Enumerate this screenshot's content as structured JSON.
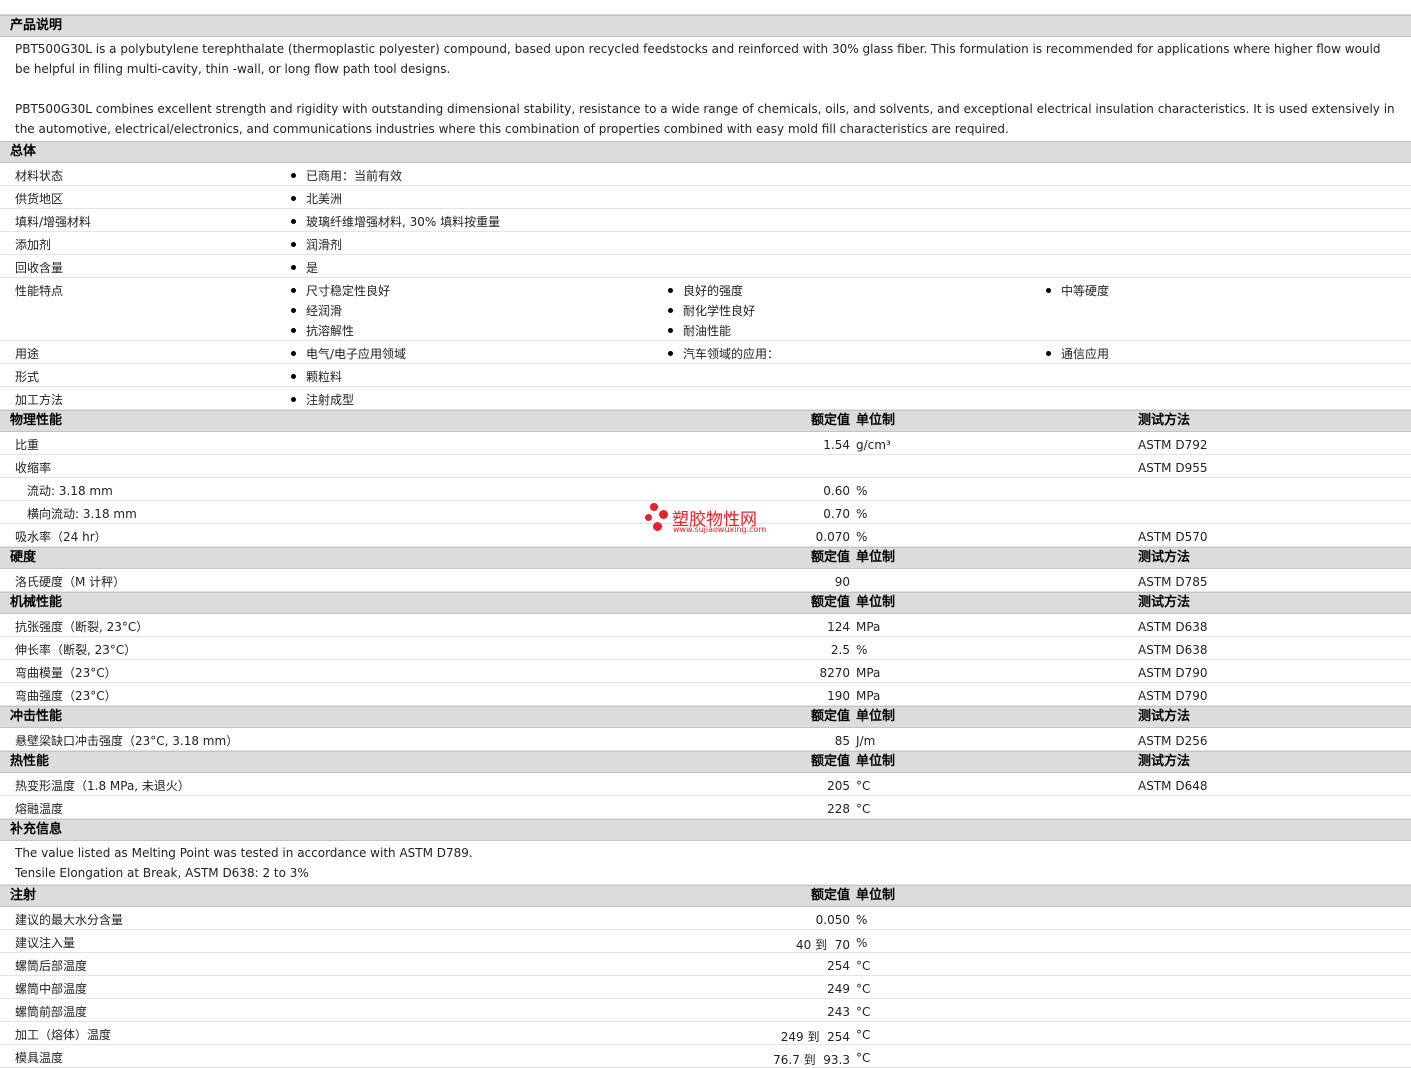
{
  "sections": {
    "desc": {
      "title": "产品说明"
    },
    "general": {
      "title": "总体"
    },
    "physical": {
      "title": "物理性能",
      "h_value": "额定值",
      "h_unit": "单位制",
      "h_method": "测试方法"
    },
    "hardness": {
      "title": "硬度",
      "h_value": "额定值",
      "h_unit": "单位制",
      "h_method": "测试方法"
    },
    "mechanical": {
      "title": "机械性能",
      "h_value": "额定值",
      "h_unit": "单位制",
      "h_method": "测试方法"
    },
    "impact": {
      "title": "冲击性能",
      "h_value": "额定值",
      "h_unit": "单位制",
      "h_method": "测试方法"
    },
    "thermal": {
      "title": "热性能",
      "h_value": "额定值",
      "h_unit": "单位制",
      "h_method": "测试方法"
    },
    "supplement": {
      "title": "补充信息"
    },
    "injection": {
      "title": "注射",
      "h_value": "额定值",
      "h_unit": "单位制"
    }
  },
  "description": {
    "p1": "PBT500G30L is a polybutylene terephthalate (thermoplastic polyester) compound, based upon recycled feedstocks and reinforced with 30% glass fiber. This formulation is recommended for applications where higher flow would be helpful in filing multi-cavity, thin -wall, or long flow path tool designs.",
    "p2": "PBT500G30L combines excellent strength and rigidity with outstanding dimensional stability, resistance to a wide range of chemicals, oils, and solvents, and exceptional electrical insulation characteristics. It is used extensively in the automotive, electrical/electronics, and communications industries where this combination of properties combined with easy mold fill characteristics are required."
  },
  "general": {
    "status": {
      "label": "材料状态",
      "v": "已商用：当前有效"
    },
    "region": {
      "label": "供货地区",
      "v": "北美洲"
    },
    "filler": {
      "label": "填料/增强材料",
      "v": "玻璃纤维增强材料, 30% 填料按重量"
    },
    "additive": {
      "label": "添加剂",
      "v": "润滑剂"
    },
    "recycled": {
      "label": "回收含量",
      "v": "是"
    },
    "features": {
      "label": "性能特点",
      "a": "尺寸稳定性良好",
      "b": "经润滑",
      "c": "抗溶解性",
      "d": "良好的强度",
      "e": "耐化学性良好",
      "f": "耐油性能",
      "g": "中等硬度"
    },
    "uses": {
      "label": "用途",
      "a": "电气/电子应用领域",
      "b": "汽车领域的应用：",
      "c": "通信应用"
    },
    "form": {
      "label": "形式",
      "v": "颗粒料"
    },
    "processing": {
      "label": "加工方法",
      "v": "注射成型"
    }
  },
  "physical": {
    "gravity": {
      "label": "比重",
      "v": "1.54",
      "u": "g/cm³",
      "m": "ASTM D792"
    },
    "shrink": {
      "label": "收缩率",
      "m": "ASTM D955"
    },
    "flow": {
      "label": "流动: 3.18 mm",
      "v": "0.60",
      "u": "%"
    },
    "cross": {
      "label": "横向流动: 3.18 mm",
      "v": "0.70",
      "u": "%"
    },
    "water": {
      "label": "吸水率（24 hr）",
      "v": "0.070",
      "u": "%",
      "m": "ASTM D570"
    }
  },
  "hardness": {
    "rockwell": {
      "label": "洛氏硬度（M 计秤）",
      "v": "90",
      "m": "ASTM D785"
    }
  },
  "mechanical": {
    "tensile": {
      "label": "抗张强度（断裂, 23°C）",
      "v": "124",
      "u": "MPa",
      "m": "ASTM D638"
    },
    "elong": {
      "label": "伸长率（断裂, 23°C）",
      "v": "2.5",
      "u": "%",
      "m": "ASTM D638"
    },
    "flexmod": {
      "label": "弯曲模量（23°C）",
      "v": "8270",
      "u": "MPa",
      "m": "ASTM D790"
    },
    "flexstr": {
      "label": "弯曲强度（23°C）",
      "v": "190",
      "u": "MPa",
      "m": "ASTM D790"
    }
  },
  "impact": {
    "izod": {
      "label": "悬壁梁缺口冲击强度（23°C, 3.18 mm）",
      "v": "85",
      "u": "J/m",
      "m": "ASTM D256"
    }
  },
  "thermal": {
    "hdt": {
      "label": "热变形温度（1.8 MPa, 未退火）",
      "v": "205",
      "u": "°C",
      "m": "ASTM D648"
    },
    "melt": {
      "label": "熔融温度",
      "v": "228",
      "u": "°C"
    }
  },
  "supplement": {
    "l1": "The value listed as Melting Point was tested in accordance with ASTM D789.",
    "l2": "Tensile Elongation at Break, ASTM D638: 2 to 3%"
  },
  "injection": {
    "moisture": {
      "label": "建议的最大水分含量",
      "v": "0.050",
      "u": "%"
    },
    "shot": {
      "label": "建议注入量",
      "v": "40 到  70",
      "u": "%"
    },
    "rear": {
      "label": "螺筒后部温度",
      "v": "254",
      "u": "°C"
    },
    "middle": {
      "label": "螺筒中部温度",
      "v": "249",
      "u": "°C"
    },
    "front": {
      "label": "螺筒前部温度",
      "v": "243",
      "u": "°C"
    },
    "processing": {
      "label": "加工（熔体）温度",
      "v": "249 到  254",
      "u": "°C"
    },
    "mold": {
      "label": "模具温度",
      "v": "76.7 到  93.3",
      "u": "°C"
    }
  },
  "watermark": {
    "text": "塑胶物性网",
    "url": "www.sujiaowuxing.com",
    "color": "#e8202a"
  }
}
